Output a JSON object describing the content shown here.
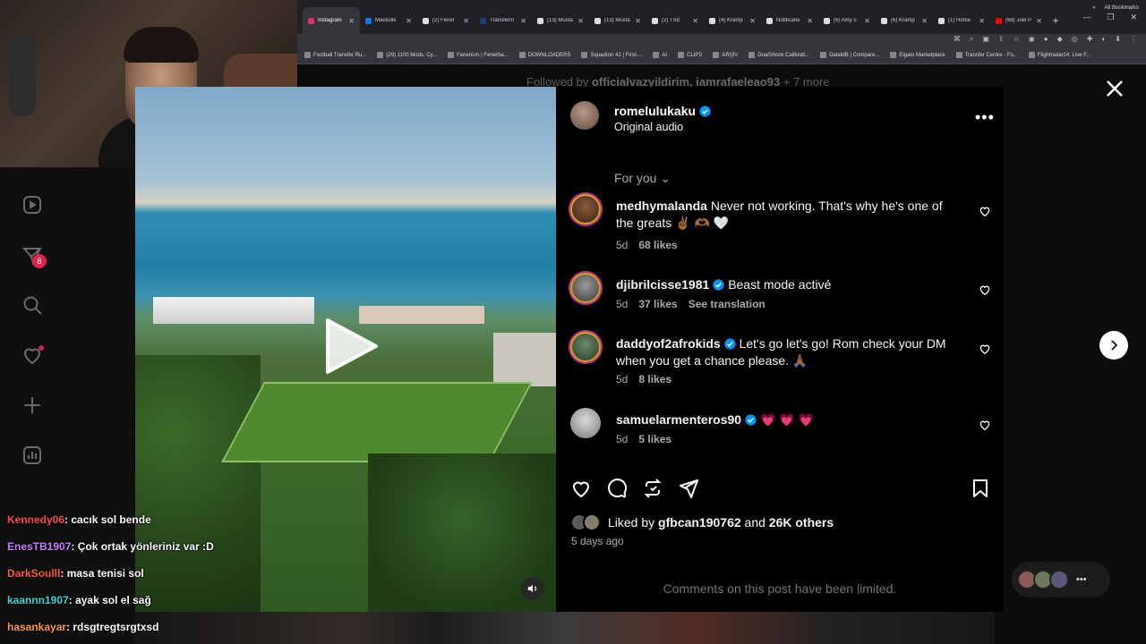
{
  "browser": {
    "tabs": [
      {
        "label": "Instagram",
        "active": true,
        "color": "#e1306c"
      },
      {
        "label": "Mackolik",
        "color": "#1a73e8"
      },
      {
        "label": "(2) Fener",
        "color": "#dddddd"
      },
      {
        "label": "Transferm",
        "color": "#1a3a8a"
      },
      {
        "label": "(13) Musta",
        "color": "#dddddd"
      },
      {
        "label": "(13) Musta",
        "color": "#dddddd"
      },
      {
        "label": "(2) TSd",
        "color": "#dddddd"
      },
      {
        "label": "(4) Kramp",
        "color": "#dddddd"
      },
      {
        "label": "Notificatio",
        "color": "#dddddd"
      },
      {
        "label": "(6) Amy o",
        "color": "#dddddd"
      },
      {
        "label": "(6) Kramp",
        "color": "#dddddd"
      },
      {
        "label": "(1) Home",
        "color": "#dddddd"
      },
      {
        "label": "(68) Joel P",
        "color": "#ff0000"
      }
    ],
    "bookmarks": [
      "Football Transfer Ru...",
      "(29) 1100 Mods. Cy...",
      "Fenerium | Fenerba...",
      "DOWNLOADERS",
      "Squadron 42 | First-...",
      "AI",
      "CLIPS",
      "ARŞİV",
      "DualShock Calibrati...",
      "DataMB | Compare...",
      "Elgato Marketplace",
      "Transfer Centre - Fo...",
      "Flightradar24: Live F..."
    ],
    "all_bookmarks": "All Bookmarks"
  },
  "background": {
    "followed_prefix": "Followed by ",
    "followed_users": "officialvazyildirim, iamrafaeleao93",
    "followed_suffix": " + 7 more"
  },
  "sidebar": {
    "notifications_badge": "8"
  },
  "post": {
    "author": "romelulukaku",
    "audio": "Original audio",
    "more_label": "•••",
    "filter_label": "For you",
    "comments": [
      {
        "user": "medhymalanda",
        "verified": false,
        "text": "Never not working. That's why he's one of the greats ✌🏾 🫶🏾 🤍",
        "age": "5d",
        "likes": "68 likes",
        "extra": ""
      },
      {
        "user": "djibrilcisse1981",
        "verified": true,
        "text": "Beast mode activé",
        "age": "5d",
        "likes": "37 likes",
        "extra": "See translation"
      },
      {
        "user": "daddyof2afrokids",
        "verified": true,
        "text": "Let's go let's go! Rom check your DM when you get a chance please. 🙏🏾",
        "age": "5d",
        "likes": "8 likes",
        "extra": ""
      },
      {
        "user": "samuelarmenteros90",
        "verified": true,
        "text": "💗 💗 💗",
        "age": "5d",
        "likes": "5 likes",
        "extra": ""
      }
    ],
    "liked_by_prefix": "Liked by ",
    "liked_by_user": "gfbcan190762",
    "liked_by_mid": " and ",
    "liked_by_others": "26K others",
    "date_ago": "5 days ago",
    "comments_limited": "Comments on this post have been limited."
  },
  "chat": [
    {
      "user": "Kennedy06",
      "message": "cacık sol bende",
      "color": "#ff4a4a"
    },
    {
      "user": "EnesTB1907",
      "message": "Çok ortak yönleriniz var :D",
      "color": "#c97cff"
    },
    {
      "user": "DarkSoulll",
      "message": "masa tenisi sol",
      "color": "#ff5a3c"
    },
    {
      "user": "kaannn1907",
      "message": "ayak sol el sağ",
      "color": "#3cd6d6"
    },
    {
      "user": "hasankayar",
      "message": "rdsgtregtsrgtxsd",
      "color": "#ff9a3c"
    }
  ],
  "colors": {
    "verified_blue": "#0095f6",
    "notification_red": "#e0244a"
  }
}
